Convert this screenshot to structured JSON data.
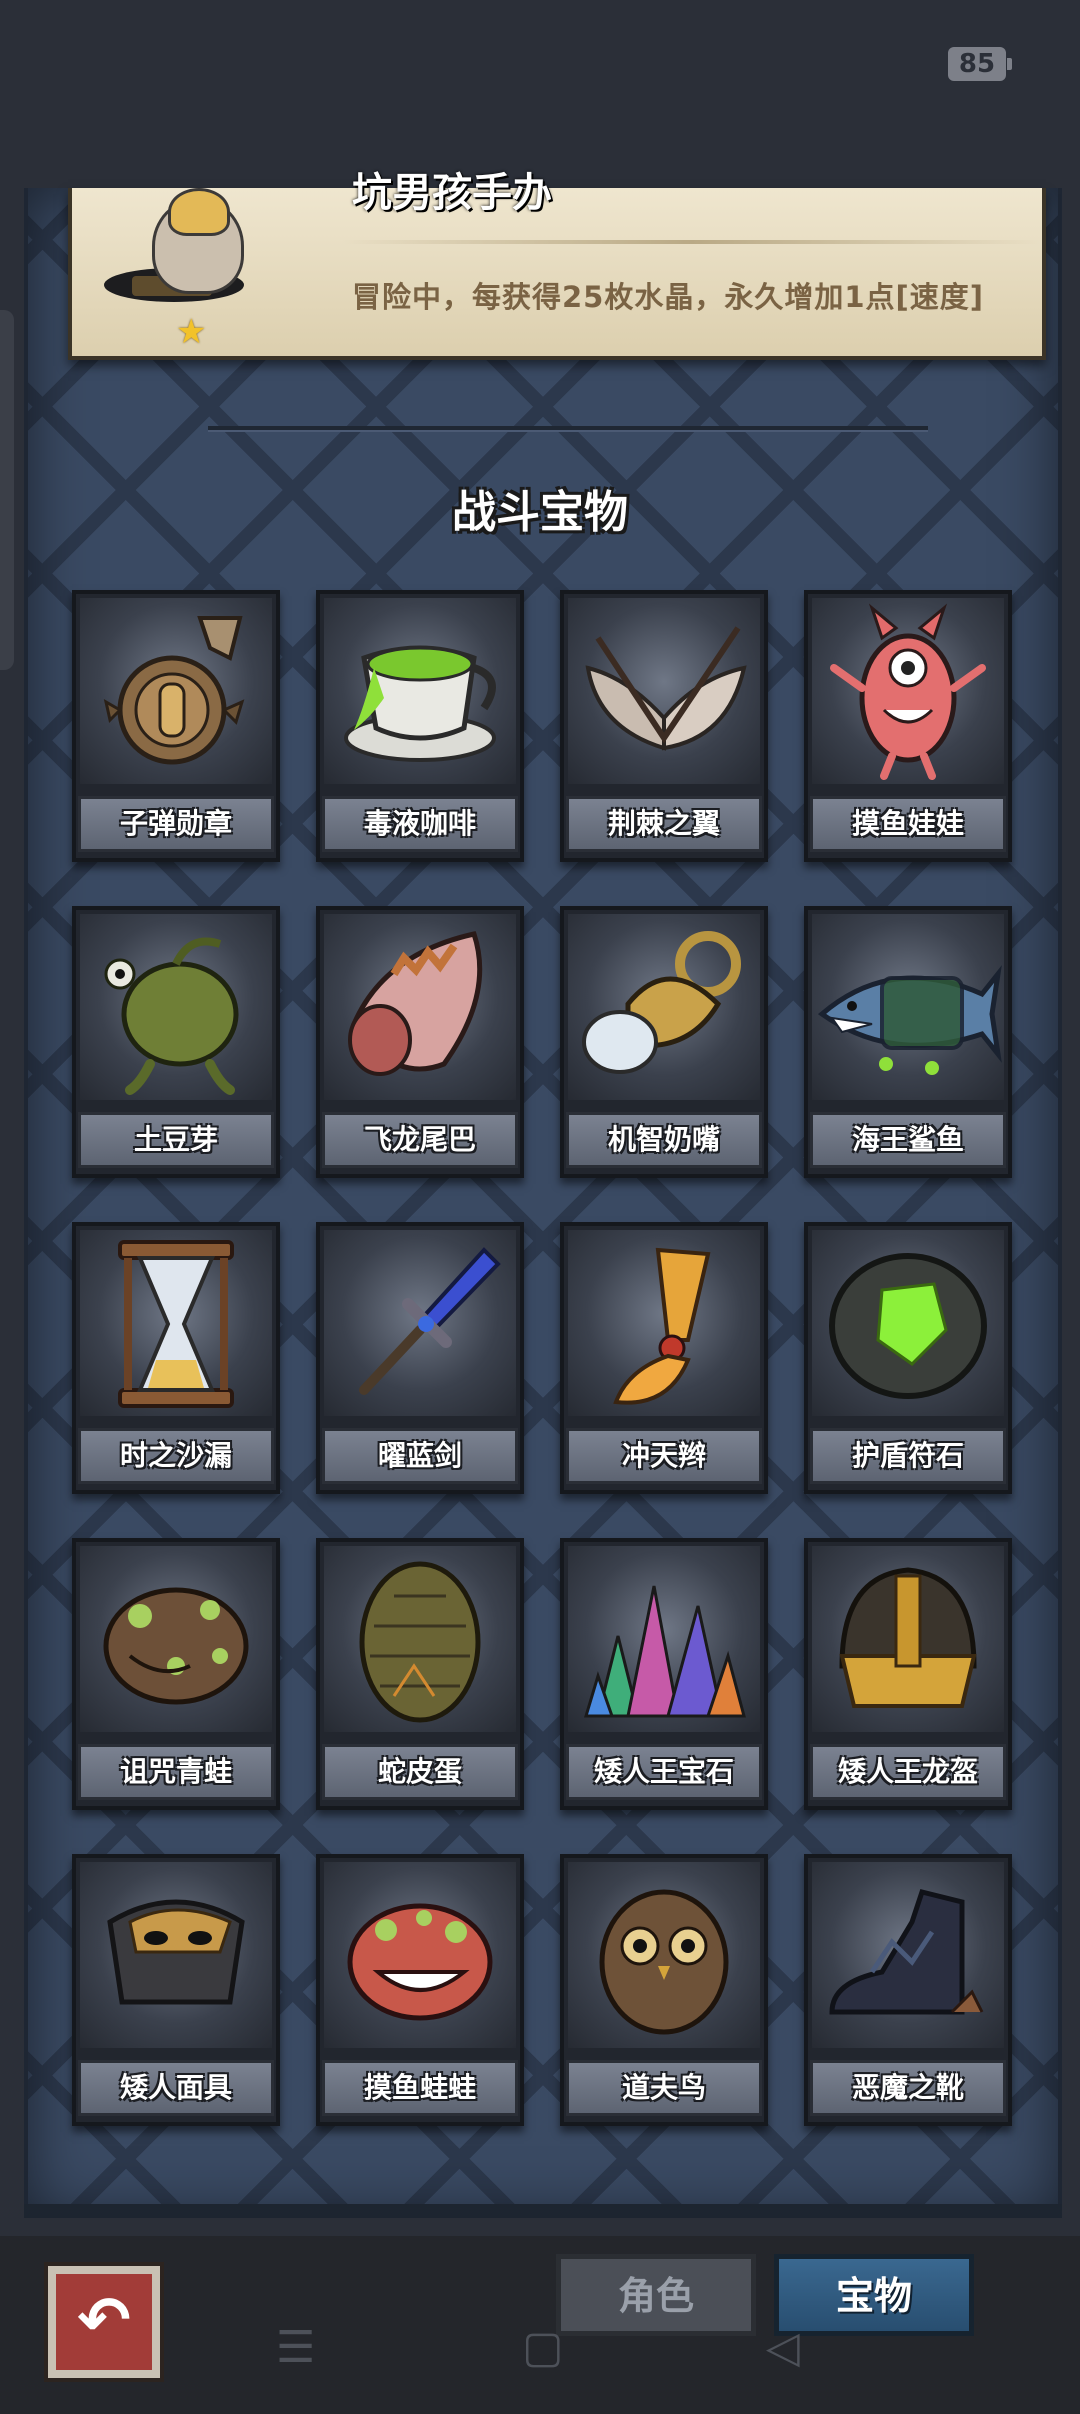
{
  "status_bar": {
    "battery": "85"
  },
  "hero": {
    "title": "坑男孩手办",
    "description": "冒险中，每获得25枚水晶，永久增加1点[速度]"
  },
  "section_title": "战斗宝物",
  "items": [
    {
      "label": "子弹勋章",
      "icon": "bullet-medal-icon"
    },
    {
      "label": "毒液咖啡",
      "icon": "venom-coffee-icon"
    },
    {
      "label": "荆棘之翼",
      "icon": "thorn-wings-icon"
    },
    {
      "label": "摸鱼娃娃",
      "icon": "slacker-doll-icon"
    },
    {
      "label": "土豆芽",
      "icon": "potato-sprout-icon"
    },
    {
      "label": "飞龙尾巴",
      "icon": "dragon-tail-icon"
    },
    {
      "label": "机智奶嘴",
      "icon": "pacifier-icon"
    },
    {
      "label": "海王鲨鱼",
      "icon": "shark-icon"
    },
    {
      "label": "时之沙漏",
      "icon": "hourglass-icon"
    },
    {
      "label": "曜蓝剑",
      "icon": "blue-sword-icon"
    },
    {
      "label": "冲天辫",
      "icon": "pigtail-icon"
    },
    {
      "label": "护盾符石",
      "icon": "shield-runestone-icon"
    },
    {
      "label": "诅咒青蛙",
      "icon": "cursed-frog-icon"
    },
    {
      "label": "蛇皮蛋",
      "icon": "snakeskin-egg-icon"
    },
    {
      "label": "矮人王宝石",
      "icon": "dwarf-king-gem-icon"
    },
    {
      "label": "矮人王龙盔",
      "icon": "dwarf-king-helmet-icon"
    },
    {
      "label": "矮人面具",
      "icon": "dwarf-mask-icon"
    },
    {
      "label": "摸鱼蛙蛙",
      "icon": "slacker-frog-icon"
    },
    {
      "label": "道夫鸟",
      "icon": "owl-icon"
    },
    {
      "label": "恶魔之靴",
      "icon": "demon-boots-icon"
    }
  ],
  "tabs": [
    {
      "label": "角色",
      "active": false
    },
    {
      "label": "宝物",
      "active": true
    }
  ],
  "colors": {
    "panel": "#3a4a63",
    "active_tab": "#2f5c84",
    "back_button": "#a23c38"
  }
}
